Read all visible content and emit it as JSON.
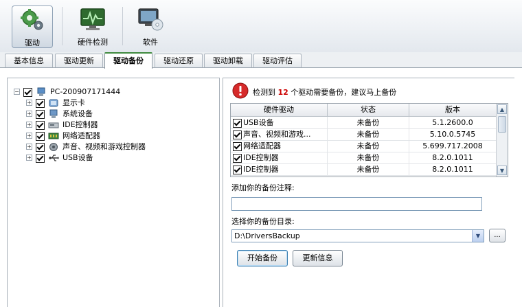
{
  "toolbar": {
    "buttons": [
      {
        "label": "驱动",
        "icon": "gears-icon"
      },
      {
        "label": "硬件检测",
        "icon": "monitor-pulse-icon"
      },
      {
        "label": "软件",
        "icon": "monitor-disc-icon"
      }
    ]
  },
  "tabs": [
    "基本信息",
    "驱动更新",
    "驱动备份",
    "驱动还原",
    "驱动卸载",
    "驱动评估"
  ],
  "active_tab": "驱动备份",
  "tree": {
    "root": "PC-200907171444",
    "children": [
      "显示卡",
      "系统设备",
      "IDE控制器",
      "网络适配器",
      "声音、视频和游戏控制器",
      "USB设备"
    ]
  },
  "message": {
    "prefix": "检测到",
    "count": "12",
    "suffix": "个驱动需要备份，建议马上备份"
  },
  "table": {
    "headers": [
      "硬件驱动",
      "状态",
      "版本"
    ],
    "rows": [
      {
        "name": "USB设备",
        "status": "未备份",
        "version": "5.1.2600.0"
      },
      {
        "name": "声音、视频和游戏...",
        "status": "未备份",
        "version": "5.10.0.5745"
      },
      {
        "name": "网络适配器",
        "status": "未备份",
        "version": "5.699.717.2008"
      },
      {
        "name": "IDE控制器",
        "status": "未备份",
        "version": "8.2.0.1011"
      },
      {
        "name": "IDE控制器",
        "status": "未备份",
        "version": "8.2.0.1011"
      }
    ]
  },
  "form": {
    "note_label": "添加你的备份注释:",
    "note_value": "",
    "dir_label": "选择你的备份目录:",
    "dir_value": "D:\\DriversBackup",
    "browse_label": "...",
    "start_label": "开始备份",
    "refresh_label": "更新信息"
  }
}
